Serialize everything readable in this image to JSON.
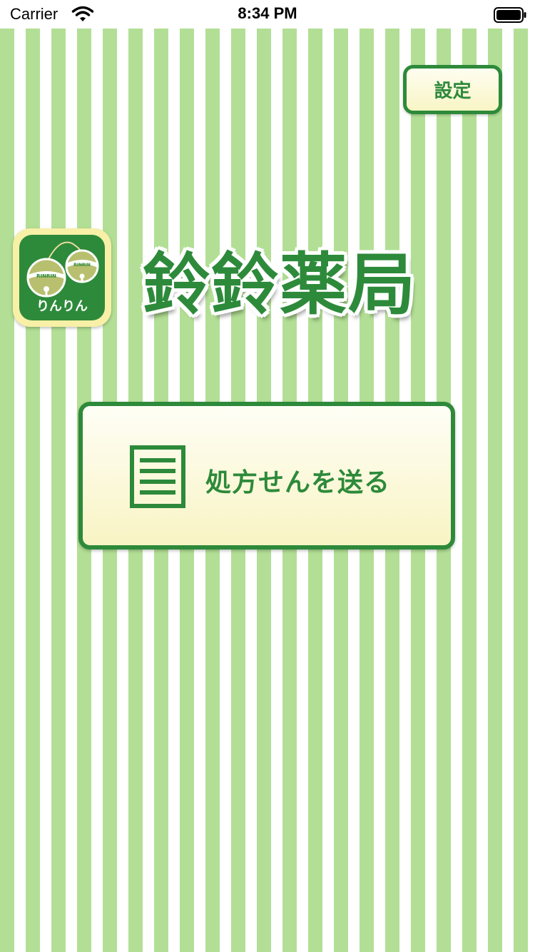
{
  "status_bar": {
    "carrier": "Carrier",
    "time": "8:34 PM"
  },
  "header": {
    "settings_label": "設定"
  },
  "brand": {
    "logo_text": "りんりん",
    "logo_bell_text": "RINRIN",
    "title": "鈴鈴薬局"
  },
  "main": {
    "send_prescription_label": "処方せんを送る"
  },
  "icons": {
    "wifi": "wifi-icon",
    "battery": "battery-icon",
    "logo": "bells-icon",
    "document": "document-icon"
  },
  "colors": {
    "primary_green": "#2d8a3a",
    "stripe_green": "#b2df95",
    "button_cream": "#f8f4c4",
    "logo_yellow": "#f7f0a6"
  }
}
